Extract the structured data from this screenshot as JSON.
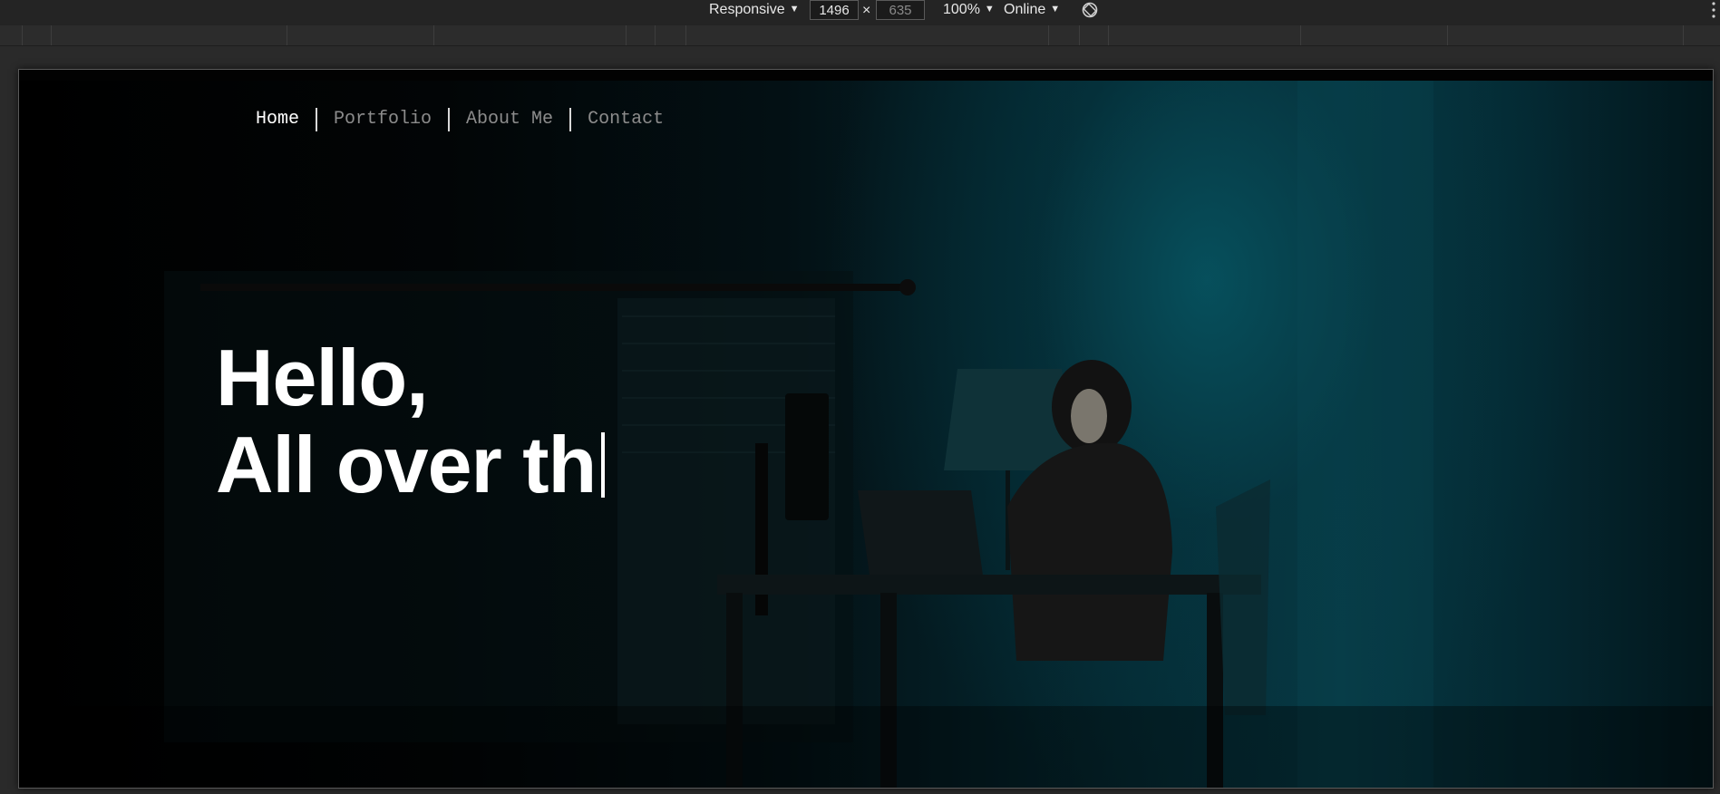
{
  "devtools": {
    "device_mode": "Responsive",
    "width": "1496",
    "height": "635",
    "times_symbol": "×",
    "zoom": "100%",
    "throttling": "Online",
    "icons": [
      "rotate-icon",
      "more-options-icon"
    ]
  },
  "page": {
    "nav": {
      "items": [
        {
          "label": "Home",
          "active": true
        },
        {
          "label": "Portfolio",
          "active": false
        },
        {
          "label": "About Me",
          "active": false
        },
        {
          "label": "Contact",
          "active": false
        }
      ]
    },
    "hero": {
      "line1": "Hello,",
      "line2": "All over th"
    },
    "colors": {
      "background": "#000000",
      "accent_teal": "#063843",
      "nav_active": "#ffffff",
      "nav_inactive": "#8c8c8c"
    }
  }
}
